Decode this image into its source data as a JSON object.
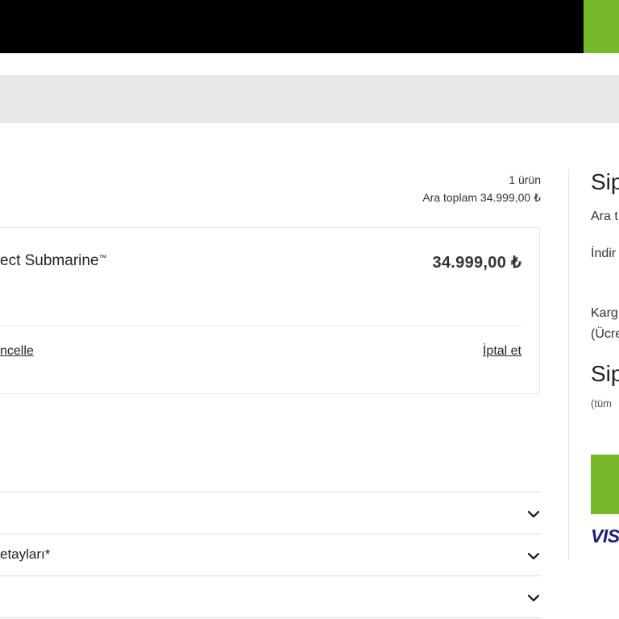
{
  "cart": {
    "item_count": "1 ürün",
    "subtotal": "Ara toplam 34.999,00 ₺"
  },
  "item": {
    "name": "ect Submarine",
    "trademark": "™",
    "price": "34.999,00 ₺",
    "update_label": "ncelle",
    "cancel_label": "İptal et"
  },
  "accordions": [
    {
      "label": ""
    },
    {
      "label": "etayları*"
    },
    {
      "label": ""
    }
  ],
  "summary": {
    "title": "Sip",
    "subtotal_label": "Ara t",
    "discount_label": "İndir",
    "shipping_label": "Karg",
    "shipping_note": "(Ücre",
    "total_label": "Sip",
    "tax_note": "(tüm",
    "payment_logo_text": "VIS"
  },
  "colors": {
    "header_bg": "#000000",
    "accent_green": "#76b82a",
    "band_gray": "#e8e8e8"
  }
}
